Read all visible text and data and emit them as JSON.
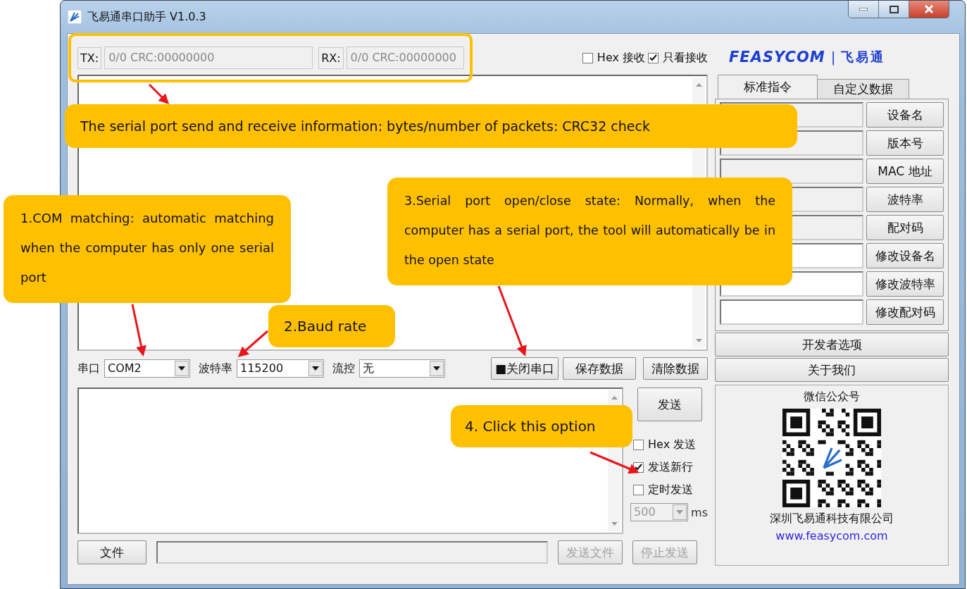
{
  "window": {
    "title": "飞易通串口助手 V1.0.3"
  },
  "counters": [
    {
      "label": "TX:",
      "value": "0/0 CRC:00000000",
      "disabled": true
    },
    {
      "label": "RX:",
      "value": "0/0 CRC:00000000",
      "disabled": true
    }
  ],
  "receive_options": [
    {
      "label": "Hex 接收",
      "checked": false
    },
    {
      "label": "只看接收",
      "checked": true
    }
  ],
  "logo": {
    "brand": "FEASYCOM",
    "separator": "|",
    "name": "飞易通"
  },
  "tabs": [
    {
      "label": "标准指令",
      "selected": true
    },
    {
      "label": "自定义数据",
      "selected": false
    }
  ],
  "commands": [
    {
      "button": "设备名",
      "editable": false
    },
    {
      "button": "版本号",
      "editable": false
    },
    {
      "button": "MAC 地址",
      "editable": false
    },
    {
      "button": "波特率",
      "editable": false
    },
    {
      "button": "配对码",
      "editable": false
    },
    {
      "button": "修改设备名",
      "editable": true
    },
    {
      "button": "修改波特率",
      "editable": true
    },
    {
      "button": "修改配对码",
      "editable": true
    }
  ],
  "panel_buttons": [
    "开发者选项",
    "关于我们"
  ],
  "wechat": {
    "title": "微信公众号",
    "company": "深圳飞易通科技有限公司",
    "url": "www.feasycom.com"
  },
  "settings": [
    {
      "label": "串口",
      "value": "COM2"
    },
    {
      "label": "波特率",
      "value": "115200"
    },
    {
      "label": "流控",
      "value": "无"
    }
  ],
  "port_buttons": [
    "■关闭串口",
    "保存数据",
    "清除数据"
  ],
  "send_button": "发送",
  "send_options": [
    {
      "label": "Hex 发送",
      "checked": false
    },
    {
      "label": "发送新行",
      "checked": true
    },
    {
      "label": "定时发送",
      "checked": false
    }
  ],
  "interval": {
    "value": "500",
    "unit": "ms",
    "disabled": true
  },
  "file_row": {
    "button": "文件",
    "actions": [
      {
        "label": "发送文件",
        "disabled": true
      },
      {
        "label": "停止发送",
        "disabled": true
      }
    ]
  },
  "annotations": [
    "The serial port send and receive information: bytes/number of packets: CRC32 check",
    "1.COM matching: automatic matching when the computer has only one serial port",
    "2.Baud rate",
    "3.Serial port open/close state: Normally, when the computer has a serial port, the tool will automatically be in the open state",
    "4. Click this option"
  ]
}
